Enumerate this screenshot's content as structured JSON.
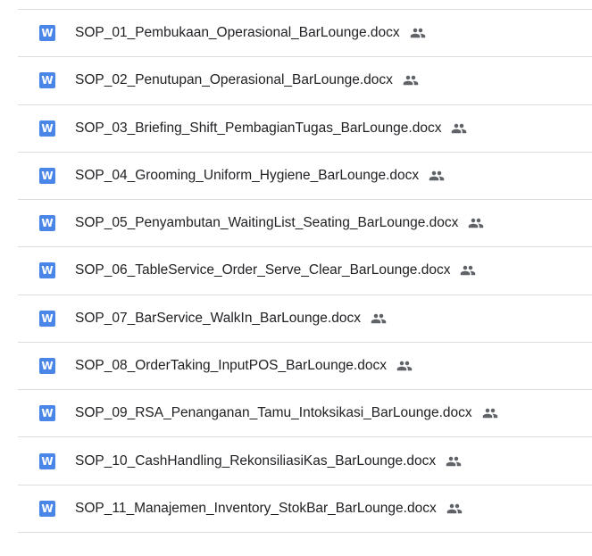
{
  "files": [
    {
      "icon_letter": "W",
      "icon": "word-doc-icon",
      "name": "SOP_01_Pembukaan_Operasional_BarLounge.docx",
      "shared_icon": "people-icon"
    },
    {
      "icon_letter": "W",
      "icon": "word-doc-icon",
      "name": "SOP_02_Penutupan_Operasional_BarLounge.docx",
      "shared_icon": "people-icon"
    },
    {
      "icon_letter": "W",
      "icon": "word-doc-icon",
      "name": "SOP_03_Briefing_Shift_PembagianTugas_BarLounge.docx",
      "shared_icon": "people-icon"
    },
    {
      "icon_letter": "W",
      "icon": "word-doc-icon",
      "name": "SOP_04_Grooming_Uniform_Hygiene_BarLounge.docx",
      "shared_icon": "people-icon"
    },
    {
      "icon_letter": "W",
      "icon": "word-doc-icon",
      "name": "SOP_05_Penyambutan_WaitingList_Seating_BarLounge.docx",
      "shared_icon": "people-icon"
    },
    {
      "icon_letter": "W",
      "icon": "word-doc-icon",
      "name": "SOP_06_TableService_Order_Serve_Clear_BarLounge.docx",
      "shared_icon": "people-icon"
    },
    {
      "icon_letter": "W",
      "icon": "word-doc-icon",
      "name": "SOP_07_BarService_WalkIn_BarLounge.docx",
      "shared_icon": "people-icon"
    },
    {
      "icon_letter": "W",
      "icon": "word-doc-icon",
      "name": "SOP_08_OrderTaking_InputPOS_BarLounge.docx",
      "shared_icon": "people-icon"
    },
    {
      "icon_letter": "W",
      "icon": "word-doc-icon",
      "name": "SOP_09_RSA_Penanganan_Tamu_Intoksikasi_BarLounge.docx",
      "shared_icon": "people-icon"
    },
    {
      "icon_letter": "W",
      "icon": "word-doc-icon",
      "name": "SOP_10_CashHandling_RekonsiliasiKas_BarLounge.docx",
      "shared_icon": "people-icon"
    },
    {
      "icon_letter": "W",
      "icon": "word-doc-icon",
      "name": "SOP_11_Manajemen_Inventory_StokBar_BarLounge.docx",
      "shared_icon": "people-icon"
    }
  ],
  "colors": {
    "word_icon": "#4a86e8",
    "text": "#202124",
    "divider": "#dadce0",
    "shared_icon": "#5f6368"
  }
}
